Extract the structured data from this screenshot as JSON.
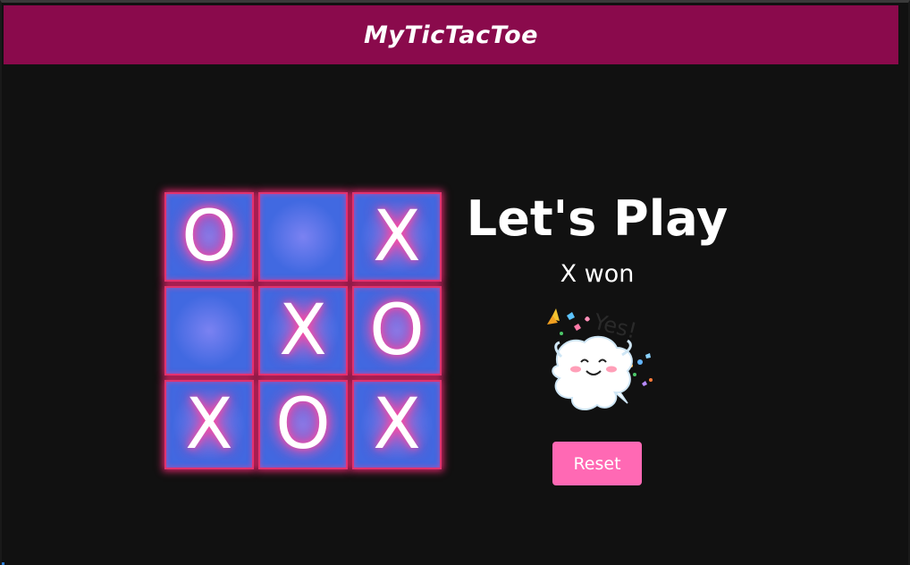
{
  "header": {
    "title": "MyTicTacToe",
    "background_color": "#8a0a4c"
  },
  "board": {
    "cells": [
      {
        "value": "O"
      },
      {
        "value": ""
      },
      {
        "value": "X"
      },
      {
        "value": ""
      },
      {
        "value": "X"
      },
      {
        "value": "O"
      },
      {
        "value": "X"
      },
      {
        "value": "O"
      },
      {
        "value": "X"
      }
    ],
    "cell_color": "#4169e1",
    "glow_color": "#ff3d9a"
  },
  "panel": {
    "heading": "Let's Play",
    "status": "X won",
    "sticker_icon": "cheering-ghost-icon",
    "sticker_text": "Yes!"
  },
  "controls": {
    "reset_label": "Reset",
    "reset_color": "#ff69b4"
  }
}
